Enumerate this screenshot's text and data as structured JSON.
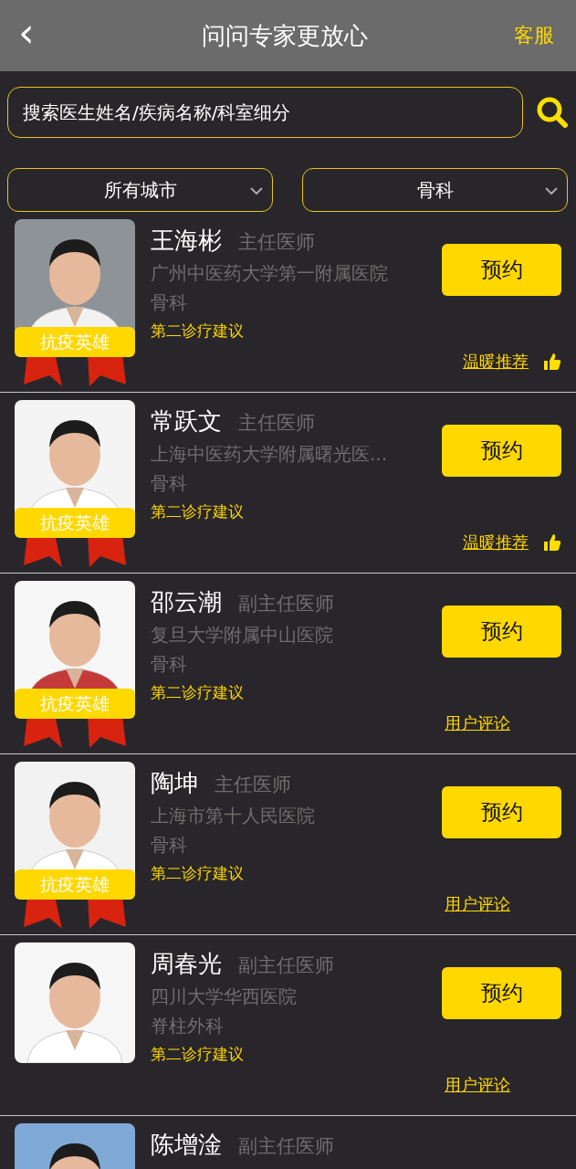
{
  "header": {
    "back": "‹",
    "title": "问问专家更放心",
    "service": "客服"
  },
  "search": {
    "placeholder": "搜索医生姓名/疾病名称/科室细分"
  },
  "filters": [
    {
      "label": "所有城市"
    },
    {
      "label": "骨科"
    }
  ],
  "doctors": [
    {
      "name": "王海彬",
      "title": "主任医师",
      "hospital": "广州中医药大学第一附属医院",
      "department": "骨科",
      "advice": "第二诊疗建议",
      "badge": "抗疫英雄",
      "button": "预约",
      "link": {
        "kind": "recommend",
        "label": "温暖推荐"
      }
    },
    {
      "name": "常跃文",
      "title": "主任医师",
      "hospital": "上海中医药大学附属曙光医...",
      "department": "骨科",
      "advice": "第二诊疗建议",
      "badge": "抗疫英雄",
      "button": "预约",
      "link": {
        "kind": "recommend",
        "label": "温暖推荐"
      }
    },
    {
      "name": "邵云潮",
      "title": "副主任医师",
      "hospital": "复旦大学附属中山医院",
      "department": "骨科",
      "advice": "第二诊疗建议",
      "badge": "抗疫英雄",
      "button": "预约",
      "link": {
        "kind": "review",
        "label": "用户评论"
      }
    },
    {
      "name": "陶坤",
      "title": "主任医师",
      "hospital": "上海市第十人民医院",
      "department": "骨科",
      "advice": "第二诊疗建议",
      "badge": "抗疫英雄",
      "button": "预约",
      "link": {
        "kind": "review",
        "label": "用户评论"
      }
    },
    {
      "name": "周春光",
      "title": "副主任医师",
      "hospital": "四川大学华西医院",
      "department": "脊柱外科",
      "advice": "第二诊疗建议",
      "button": "预约",
      "link": {
        "kind": "review",
        "label": "用户评论"
      }
    },
    {
      "name": "陈增淦",
      "title": "副主任医师"
    }
  ]
}
